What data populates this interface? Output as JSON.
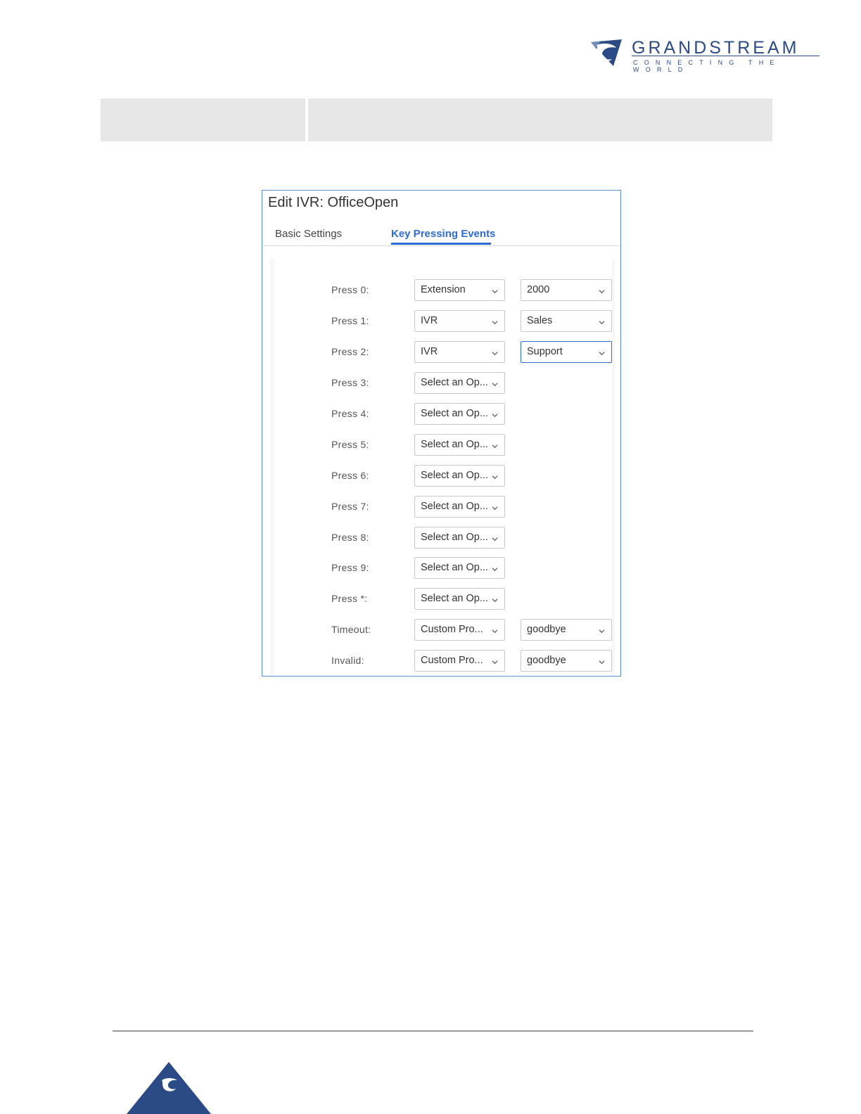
{
  "brand": {
    "name": "GRANDSTREAM",
    "tagline": "CONNECTING THE WORLD",
    "color": "#2b4b86"
  },
  "dialog": {
    "title": "Edit IVR: OfficeOpen",
    "tabs": [
      {
        "label": "Basic Settings",
        "active": false
      },
      {
        "label": "Key Pressing Events",
        "active": true
      }
    ],
    "accent_color": "#2d6bd6",
    "rows": [
      {
        "label": "Press 0:",
        "option": "Extension",
        "target": "2000"
      },
      {
        "label": "Press 1:",
        "option": "IVR",
        "target": "Sales"
      },
      {
        "label": "Press 2:",
        "option": "IVR",
        "target": "Support"
      },
      {
        "label": "Press 3:",
        "option": "Select an Op...",
        "target": null
      },
      {
        "label": "Press 4:",
        "option": "Select an Op...",
        "target": null
      },
      {
        "label": "Press 5:",
        "option": "Select an Op...",
        "target": null
      },
      {
        "label": "Press 6:",
        "option": "Select an Op...",
        "target": null
      },
      {
        "label": "Press 7:",
        "option": "Select an Op...",
        "target": null
      },
      {
        "label": "Press 8:",
        "option": "Select an Op...",
        "target": null
      },
      {
        "label": "Press 9:",
        "option": "Select an Op...",
        "target": null
      },
      {
        "label": "Press *:",
        "option": "Select an Op...",
        "target": null
      },
      {
        "label": "Timeout:",
        "option": "Custom Pro...",
        "target": "goodbye"
      },
      {
        "label": "Invalid:",
        "option": "Custom Pro...",
        "target": "goodbye"
      }
    ]
  }
}
